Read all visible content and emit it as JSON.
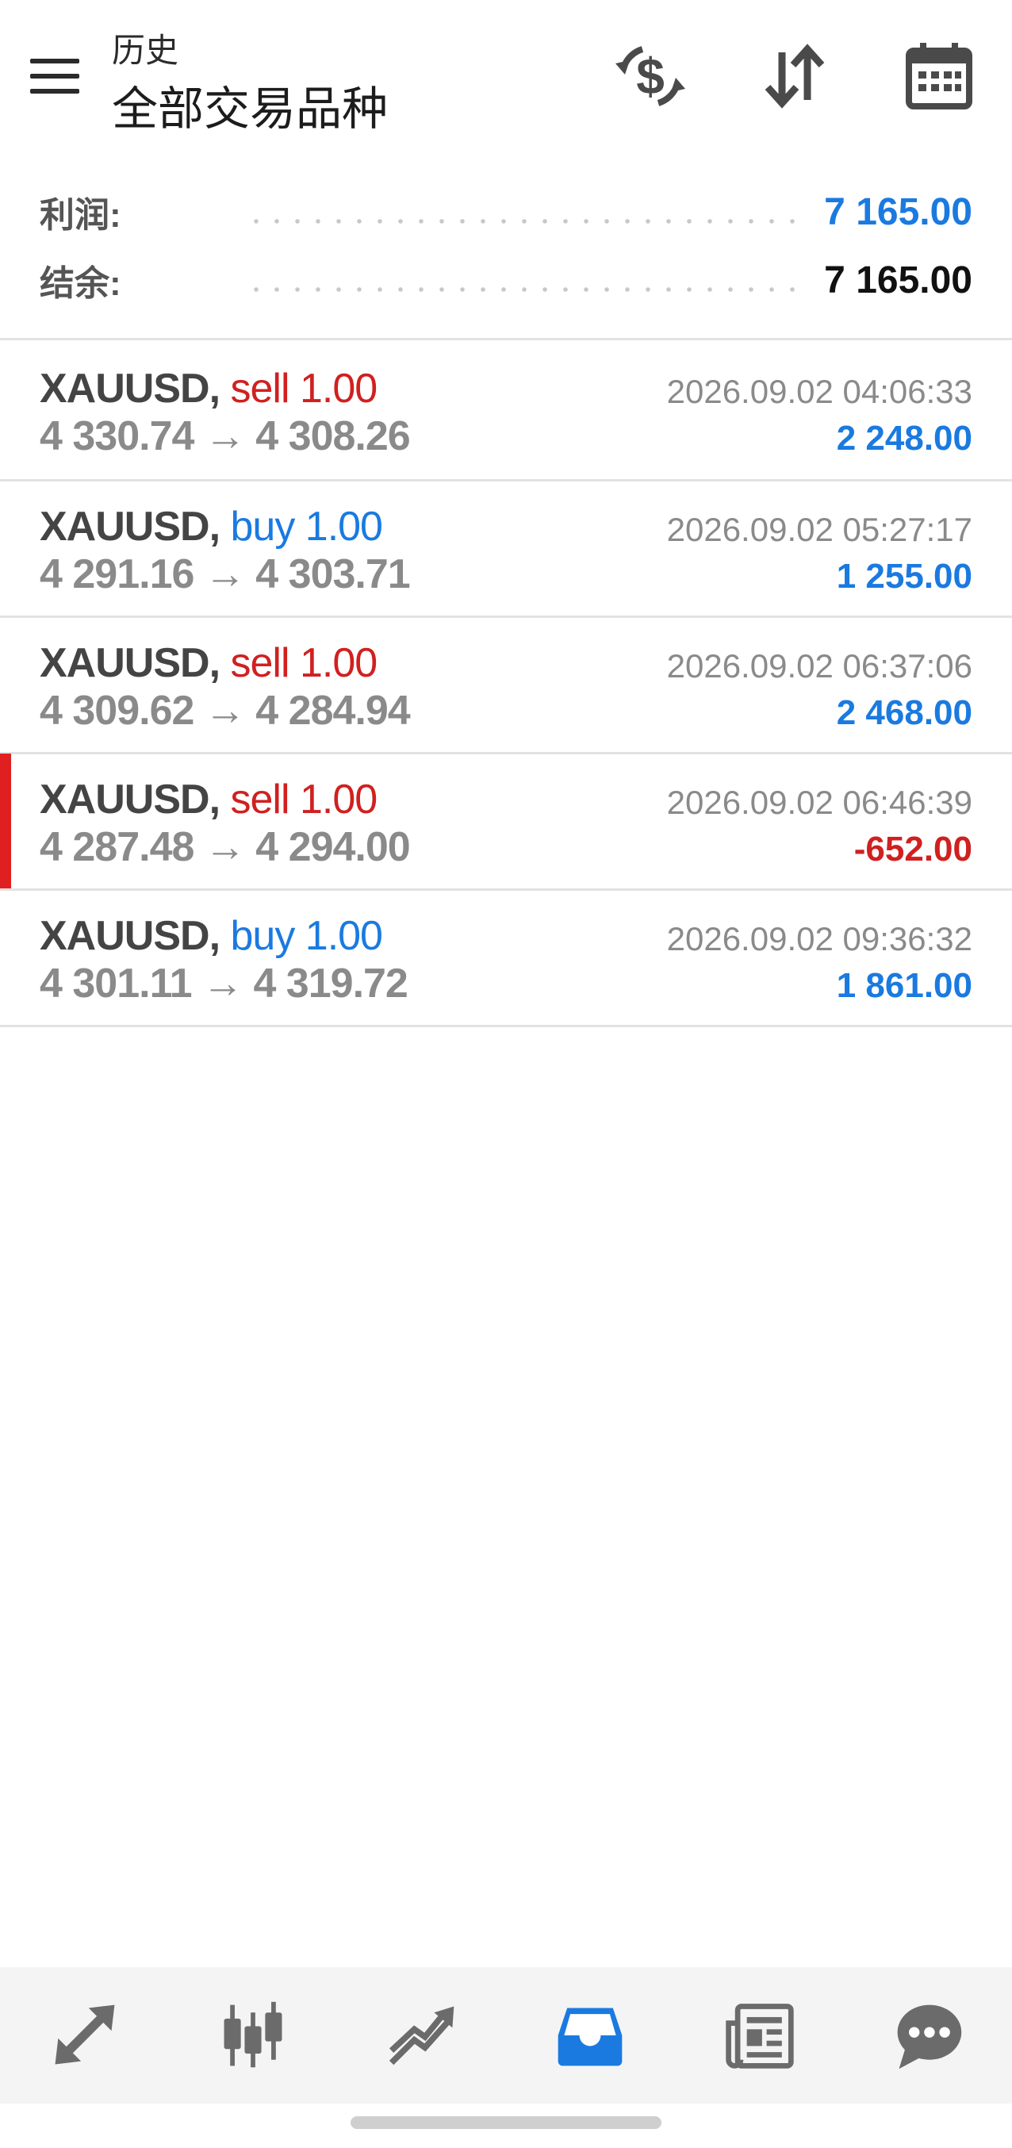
{
  "header": {
    "subtitle": "历史",
    "title": "全部交易品种"
  },
  "summary": {
    "profit_label": "利润:",
    "profit_value": "7 165.00",
    "balance_label": "结余:",
    "balance_value": "7 165.00"
  },
  "trades": [
    {
      "symbol": "XAUUSD,",
      "side": "sell 1.00",
      "prices": "4 330.74 → 4 308.26",
      "time": "2026.09.02 04:06:33",
      "profit": "2 248.00"
    },
    {
      "symbol": "XAUUSD,",
      "side": "buy 1.00",
      "prices": "4 291.16 → 4 303.71",
      "time": "2026.09.02 05:27:17",
      "profit": "1 255.00"
    },
    {
      "symbol": "XAUUSD,",
      "side": "sell 1.00",
      "prices": "4 309.62 → 4 284.94",
      "time": "2026.09.02 06:37:06",
      "profit": "2 468.00"
    },
    {
      "symbol": "XAUUSD,",
      "side": "sell 1.00",
      "prices": "4 287.48 → 4 294.00",
      "time": "2026.09.02 06:46:39",
      "profit": "-652.00"
    },
    {
      "symbol": "XAUUSD,",
      "side": "buy 1.00",
      "prices": "4 301.11 → 4 319.72",
      "time": "2026.09.02 09:36:32",
      "profit": "1 861.00"
    }
  ],
  "icons": {
    "menu": "menu-icon",
    "header_actions": [
      "dollar-refresh-icon",
      "sort-icon",
      "calendar-icon"
    ],
    "bottom_nav": [
      "quotes-icon",
      "chart-icon",
      "trade-icon",
      "history-icon",
      "news-icon",
      "chat-icon"
    ]
  },
  "colors": {
    "accent": "#1a7ae0",
    "loss": "#d02020",
    "active_nav": "#1a7ae0",
    "inactive_nav": "#6b6b6b"
  }
}
